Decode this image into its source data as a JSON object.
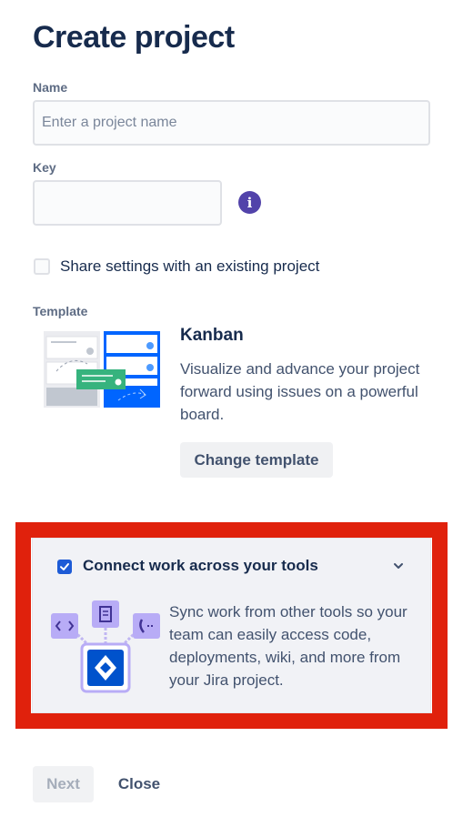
{
  "page": {
    "title": "Create project"
  },
  "name_field": {
    "label": "Name",
    "value": "",
    "placeholder": "Enter a project name"
  },
  "key_field": {
    "label": "Key",
    "value": "",
    "placeholder": "",
    "info_icon": "info-icon"
  },
  "share_settings": {
    "label": "Share settings with an existing project",
    "checked": false
  },
  "template": {
    "section_label": "Template",
    "name": "Kanban",
    "description": "Visualize and advance your project forward using issues on a powerful board.",
    "change_label": "Change template"
  },
  "connect_tools": {
    "title": "Connect work across your tools",
    "checked": true,
    "description": "Sync work from other tools so your team can easily access code, deployments, wiki, and more from your Jira project.",
    "icons": [
      "code-icon",
      "document-icon",
      "phone-icon",
      "jira-logo-icon",
      "chevron-down-icon"
    ]
  },
  "footer": {
    "next_label": "Next",
    "next_disabled": true,
    "close_label": "Close"
  },
  "colors": {
    "highlight": "#e0210c",
    "accent": "#1d5bd6",
    "info": "#5243aa"
  }
}
